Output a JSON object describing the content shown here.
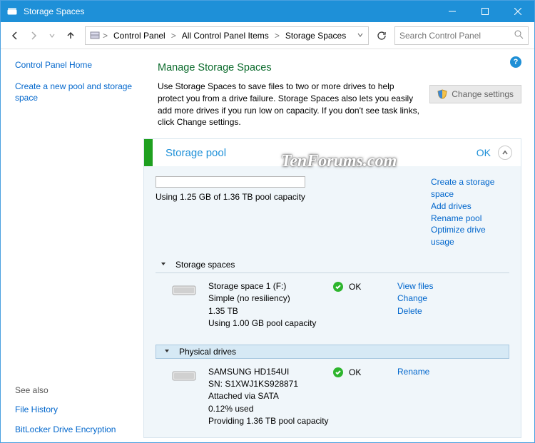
{
  "window": {
    "title": "Storage Spaces"
  },
  "breadcrumb": {
    "root_sep": ">",
    "items": [
      "Control Panel",
      "All Control Panel Items",
      "Storage Spaces"
    ],
    "sep": ">"
  },
  "search": {
    "placeholder": "Search Control Panel"
  },
  "sidebar": {
    "home": "Control Panel Home",
    "create": "Create a new pool and storage space",
    "see_also": "See also",
    "file_history": "File History",
    "bitlocker": "BitLocker Drive Encryption"
  },
  "page": {
    "title": "Manage Storage Spaces",
    "intro": "Use Storage Spaces to save files to two or more drives to help protect you from a drive failure. Storage Spaces also lets you easily add more drives if you run low on capacity. If you don't see task links, click Change settings.",
    "change_settings": "Change settings"
  },
  "pool": {
    "title": "Storage pool",
    "status": "OK",
    "capacity_text": "Using 1.25 GB of 1.36 TB pool capacity",
    "links": {
      "create": "Create a storage space",
      "add": "Add drives",
      "rename": "Rename pool",
      "optimize": "Optimize drive usage"
    },
    "spaces_header": "Storage spaces",
    "space": {
      "name": "Storage space 1 (F:)",
      "resiliency": "Simple (no resiliency)",
      "size": "1.35 TB",
      "using": "Using 1.00 GB pool capacity",
      "status": "OK",
      "links": {
        "view": "View files",
        "change": "Change",
        "delete": "Delete"
      }
    },
    "drives_header": "Physical drives",
    "drive": {
      "name": "SAMSUNG HD154UI",
      "sn": "SN: S1XWJ1KS928871",
      "attached": "Attached via SATA",
      "used": "0.12% used",
      "providing": "Providing 1.36 TB pool capacity",
      "status": "OK",
      "links": {
        "rename": "Rename"
      }
    }
  },
  "watermark": "TenForums.com"
}
